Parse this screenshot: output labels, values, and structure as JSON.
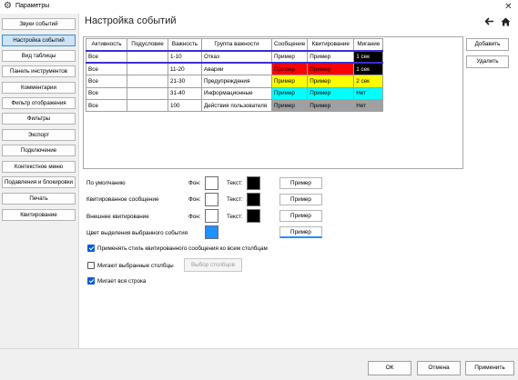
{
  "window": {
    "title": "Параметры",
    "close_glyph": "✕",
    "gear_glyph": "⚙"
  },
  "nav": {
    "items": [
      {
        "label": "Звуки событий",
        "active": false
      },
      {
        "label": "Настройка событий",
        "active": true
      },
      {
        "label": "Вид таблицы",
        "active": false
      },
      {
        "label": "Панель инструментов",
        "active": false
      },
      {
        "label": "Комментарии",
        "active": false
      },
      {
        "label": "Фильтр отображения",
        "active": false
      },
      {
        "label": "Фильтры",
        "active": false
      },
      {
        "label": "Экспорт",
        "active": false
      },
      {
        "label": "Подключение",
        "active": false
      },
      {
        "label": "Контекстное меню",
        "active": false
      },
      {
        "label": "Подавления и блокировки",
        "active": false
      },
      {
        "label": "Печать",
        "active": false
      },
      {
        "label": "Квитирование",
        "active": false
      }
    ]
  },
  "main": {
    "heading": "Настройка событий",
    "columns": [
      "Активность",
      "Подусловие",
      "Важность",
      "Группа важности",
      "Сообщение",
      "Квитирование",
      "Мигание"
    ],
    "rows": [
      {
        "activity": "Все",
        "subcondition": "",
        "importance": "1-10",
        "group": "Отказ",
        "message": "Пример",
        "message_bg": "#ffffff",
        "message_fg": "#000000",
        "ack": "Пример",
        "ack_bg": "#ffffff",
        "ack_fg": "#000000",
        "blink": "1 сек",
        "blink_bg": "#000000",
        "blink_fg": "#ffffff",
        "selected": true
      },
      {
        "activity": "Все",
        "subcondition": "",
        "importance": "11-20",
        "group": "Аварии",
        "message": "Пример",
        "message_bg": "#ff0000",
        "message_fg": "#000000",
        "ack": "Пример",
        "ack_bg": "#ff0000",
        "ack_fg": "#000000",
        "blink": "1 сек",
        "blink_bg": "#000000",
        "blink_fg": "#ffffff",
        "selected": false
      },
      {
        "activity": "Все",
        "subcondition": "",
        "importance": "21-30",
        "group": "Предупреждения",
        "message": "Пример",
        "message_bg": "#ffff00",
        "message_fg": "#000000",
        "ack": "Пример",
        "ack_bg": "#ffff00",
        "ack_fg": "#000000",
        "blink": "2 сек",
        "blink_bg": "#ffff00",
        "blink_fg": "#000000",
        "selected": false
      },
      {
        "activity": "Все",
        "subcondition": "",
        "importance": "31-40",
        "group": "Информационные",
        "message": "Пример",
        "message_bg": "#00ffff",
        "message_fg": "#000000",
        "ack": "Пример",
        "ack_bg": "#00ffff",
        "ack_fg": "#000000",
        "blink": "Нет",
        "blink_bg": "#00ffff",
        "blink_fg": "#000000",
        "selected": false
      },
      {
        "activity": "Все",
        "subcondition": "",
        "importance": "100",
        "group": "Действия пользователя",
        "message": "Пример",
        "message_bg": "#a0a0a0",
        "message_fg": "#000000",
        "ack": "Пример",
        "ack_bg": "#a0a0a0",
        "ack_fg": "#000000",
        "blink": "Нет",
        "blink_bg": "#a0a0a0",
        "blink_fg": "#000000",
        "selected": false
      }
    ],
    "add_label": "Добавить",
    "delete_label": "Удалить"
  },
  "styles": {
    "bg_label": "Фон:",
    "text_label": "Текст:",
    "preview_label": "Пример",
    "default": {
      "label": "По умолчанию",
      "bg": "#ffffff",
      "fg": "#000000"
    },
    "acknowledged": {
      "label": "Квитированное сообщение",
      "bg": "#ffffff",
      "fg": "#000000"
    },
    "external_ack": {
      "label": "Внешнее квитирование",
      "bg": "#ffffff",
      "fg": "#000000"
    },
    "selected_row": {
      "label": "Цвет выделения выбранного события",
      "color": "#1e90ff"
    }
  },
  "options": {
    "apply_ack_style": {
      "label": "Применять стиль квитированного сообщения ко всем столбцам",
      "checked": true
    },
    "blink_selected_columns": {
      "label": "Мигают выбранные столбцы",
      "checked": false
    },
    "pick_columns_label": "Выбор столбцов",
    "blink_whole_row": {
      "label": "Мигает вся строка",
      "checked": true
    }
  },
  "footer": {
    "ok": "ОК",
    "cancel": "Отмена",
    "apply": "Применить"
  },
  "icons": {
    "title": "gear-icon",
    "back": "back-arrow-icon",
    "home": "home-icon",
    "close": "close-icon"
  }
}
